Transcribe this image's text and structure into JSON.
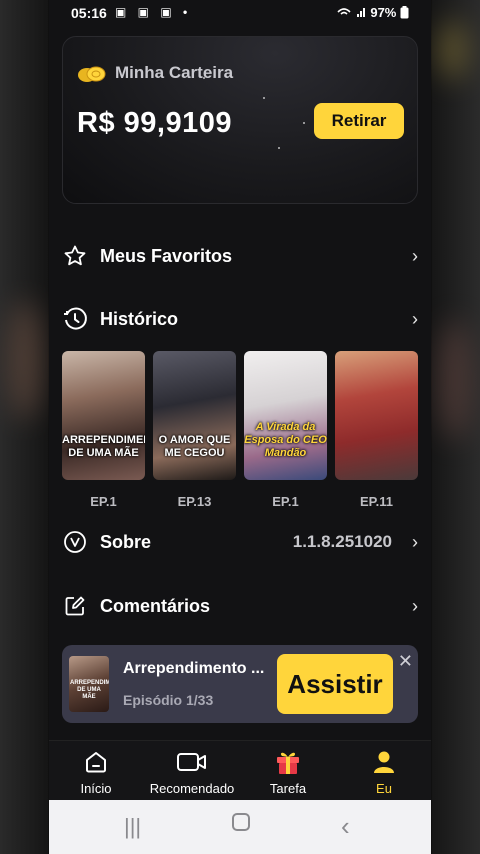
{
  "status_bar": {
    "time": "05:16",
    "left_icons": "▣ ▣ ▣ •",
    "right_text": "97%"
  },
  "wallet": {
    "title": "Minha Carteira",
    "amount": "R$ 99,9109",
    "withdraw_label": "Retirar"
  },
  "menu": {
    "favorites_label": "Meus Favoritos",
    "history_label": "Histórico",
    "about_label": "Sobre",
    "about_version": "1.1.8.251020",
    "feedback_label": "Comentários"
  },
  "history": [
    {
      "caption": "ARREPENDIMENTO DE UMA MÃE",
      "episode": "EP.1"
    },
    {
      "caption": "O AMOR QUE ME CEGOU",
      "episode": "EP.13"
    },
    {
      "caption": "A Virada da Esposa do CEO Mandão",
      "episode": "EP.1"
    },
    {
      "caption": "",
      "episode": "EP.11"
    }
  ],
  "mini_player": {
    "thumb_caption": "ARREPENDIMENTO DE UMA MÃE",
    "title": "Arrependimento ...",
    "subtitle": "Episódio 1/33",
    "watch_label": "Assistir"
  },
  "tabs": [
    {
      "label": "Início",
      "icon": "home-icon"
    },
    {
      "label": "Recomendado",
      "icon": "video-camera-icon"
    },
    {
      "label": "Tarefa",
      "icon": "gift-icon"
    },
    {
      "label": "Eu",
      "icon": "person-icon",
      "active": true
    }
  ],
  "colors": {
    "accent": "#ffd53b",
    "background": "#121214",
    "mini_player_bg": "#3a3a4a"
  }
}
